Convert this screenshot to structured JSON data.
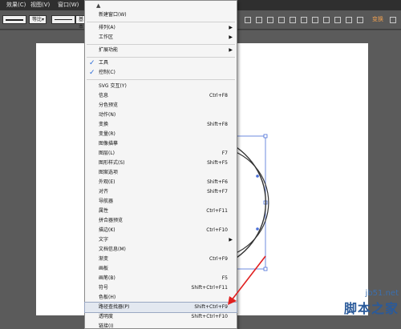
{
  "menubar": {
    "items": [
      "效果(C)",
      "视图(V)",
      "窗口(W)"
    ]
  },
  "controlbar": {
    "stroke_profile": "等比",
    "brush": "基本",
    "transform_label": "变换"
  },
  "menu": {
    "items": [
      {
        "label": "新建窗口(W)",
        "shortcut": "",
        "submenu": false,
        "checked": false
      },
      {
        "label": "排列(A)",
        "shortcut": "",
        "submenu": true,
        "checked": false
      },
      {
        "label": "工作区",
        "shortcut": "",
        "submenu": true,
        "checked": false
      },
      {
        "label": "扩展功能",
        "shortcut": "",
        "submenu": true,
        "checked": false
      },
      {
        "label": "工具",
        "shortcut": "",
        "submenu": false,
        "checked": true
      },
      {
        "label": "控制(C)",
        "shortcut": "",
        "submenu": false,
        "checked": true
      },
      {
        "label": "SVG 交互(Y)",
        "shortcut": "",
        "submenu": false,
        "checked": false
      },
      {
        "label": "信息",
        "shortcut": "Ctrl+F8",
        "submenu": false,
        "checked": false
      },
      {
        "label": "分色预览",
        "shortcut": "",
        "submenu": false,
        "checked": false
      },
      {
        "label": "动作(N)",
        "shortcut": "",
        "submenu": false,
        "checked": false
      },
      {
        "label": "变换",
        "shortcut": "Shift+F8",
        "submenu": false,
        "checked": false
      },
      {
        "label": "变量(R)",
        "shortcut": "",
        "submenu": false,
        "checked": false
      },
      {
        "label": "图像描摹",
        "shortcut": "",
        "submenu": false,
        "checked": false
      },
      {
        "label": "图层(L)",
        "shortcut": "F7",
        "submenu": false,
        "checked": false
      },
      {
        "label": "图形样式(S)",
        "shortcut": "Shift+F5",
        "submenu": false,
        "checked": false
      },
      {
        "label": "图案选项",
        "shortcut": "",
        "submenu": false,
        "checked": false
      },
      {
        "label": "外观(E)",
        "shortcut": "Shift+F6",
        "submenu": false,
        "checked": false
      },
      {
        "label": "对齐",
        "shortcut": "Shift+F7",
        "submenu": false,
        "checked": false
      },
      {
        "label": "导航器",
        "shortcut": "",
        "submenu": false,
        "checked": false
      },
      {
        "label": "属性",
        "shortcut": "Ctrl+F11",
        "submenu": false,
        "checked": false
      },
      {
        "label": "拼合器预览",
        "shortcut": "",
        "submenu": false,
        "checked": false
      },
      {
        "label": "描边(K)",
        "shortcut": "Ctrl+F10",
        "submenu": false,
        "checked": false
      },
      {
        "label": "文字",
        "shortcut": "",
        "submenu": true,
        "checked": false
      },
      {
        "label": "文档信息(M)",
        "shortcut": "",
        "submenu": false,
        "checked": false
      },
      {
        "label": "渐变",
        "shortcut": "Ctrl+F9",
        "submenu": false,
        "checked": false
      },
      {
        "label": "画板",
        "shortcut": "",
        "submenu": false,
        "checked": false
      },
      {
        "label": "画笔(B)",
        "shortcut": "F5",
        "submenu": false,
        "checked": false
      },
      {
        "label": "符号",
        "shortcut": "Shift+Ctrl+F11",
        "submenu": false,
        "checked": false
      },
      {
        "label": "色板(H)",
        "shortcut": "",
        "submenu": false,
        "checked": false
      },
      {
        "label": "路径查找器(P)",
        "shortcut": "Shift+Ctrl+F9",
        "submenu": false,
        "checked": false,
        "highlighted": true
      },
      {
        "label": "透明度",
        "shortcut": "Shift+Ctrl+F10",
        "submenu": false,
        "checked": false
      },
      {
        "label": "链接(I)",
        "shortcut": "",
        "submenu": false,
        "checked": false
      }
    ]
  },
  "watermark": {
    "logo": "jb51.net",
    "brand": "脚本之家"
  },
  "colors": {
    "accent_transform": "#f0a050",
    "annotation_arrow": "#e02020",
    "selection_blue": "#4a6fd8"
  }
}
